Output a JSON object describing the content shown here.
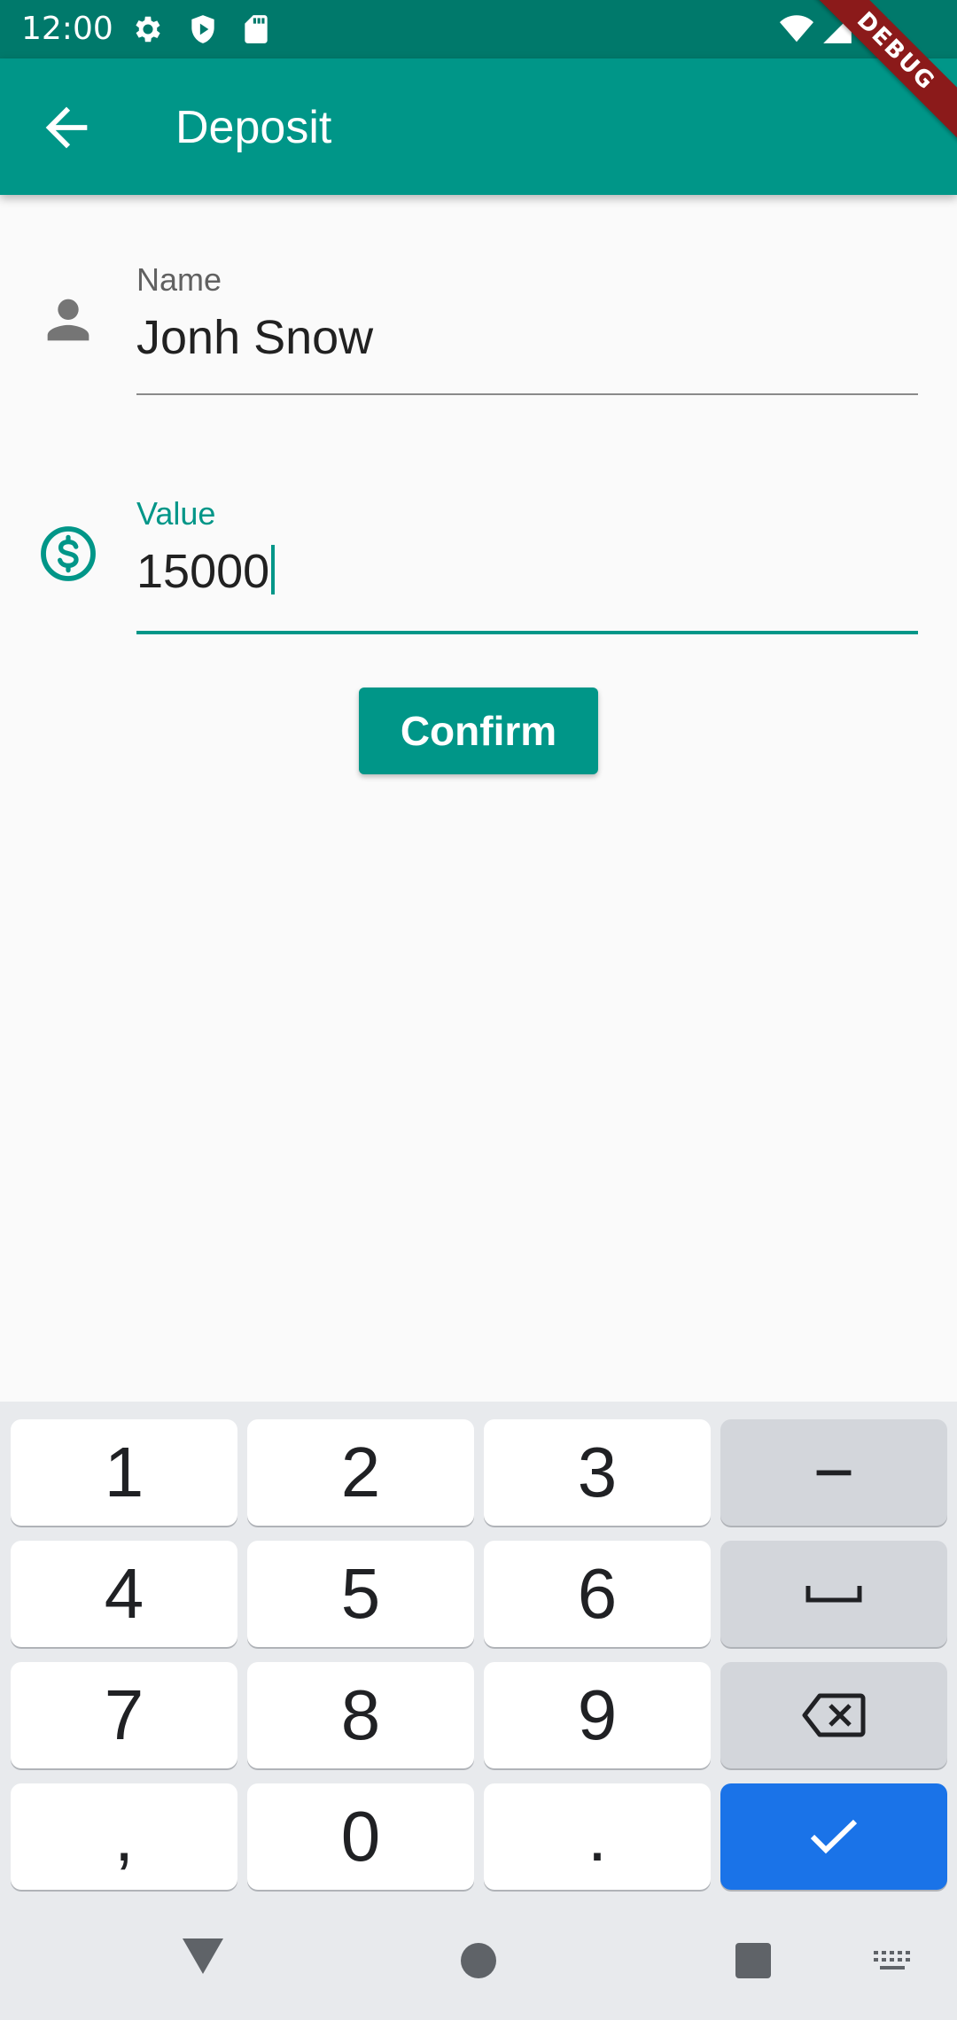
{
  "status_bar": {
    "time": "12:00",
    "left_icons": [
      "settings-icon",
      "shield-play-icon",
      "sd-card-icon"
    ],
    "right_icons": [
      "wifi-icon",
      "cell-signal-icon",
      "battery-icon"
    ]
  },
  "debug_banner": "DEBUG",
  "app_bar": {
    "title": "Deposit",
    "back_icon": "arrow-back-icon",
    "color": "#009688"
  },
  "form": {
    "name_field": {
      "label": "Name",
      "value": "Jonh Snow",
      "icon": "person-icon"
    },
    "value_field": {
      "label": "Value",
      "value": "15000",
      "icon": "dollar-circle-icon",
      "focused": true
    },
    "confirm_label": "Confirm"
  },
  "keyboard": {
    "rows": [
      [
        "1",
        "2",
        "3",
        "−"
      ],
      [
        "4",
        "5",
        "6",
        "space"
      ],
      [
        "7",
        "8",
        "9",
        "backspace"
      ],
      [
        ",",
        "0",
        ".",
        "done"
      ]
    ],
    "special_icons": {
      "space": "space-icon",
      "backspace": "backspace-icon",
      "done": "check-icon"
    },
    "action_color": "#1a73e8"
  },
  "nav_bar": {
    "buttons": [
      "back-triangle-icon",
      "home-circle-icon",
      "recents-square-icon",
      "keyboard-switch-icon"
    ]
  },
  "colors": {
    "primary": "#009688",
    "primary_dark": "#00796b",
    "background": "#fafafa"
  }
}
